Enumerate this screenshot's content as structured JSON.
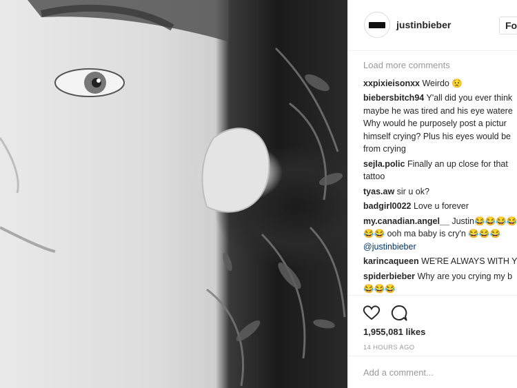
{
  "post": {
    "photo_icon": "photo-bw-portrait",
    "username": "justinbieber",
    "follow_label": "Fol",
    "load_more": "Load more comments",
    "comments": [
      {
        "author": "xxpixieisonxx",
        "text": "Weirdo 😟",
        "link": ""
      },
      {
        "author": "biebersbitch94",
        "text": "Y'all did you ever think\nmaybe he was tired and his eye watere\nWhy would he purposely post a pictur\nhimself crying? Plus his eyes would be\nfrom crying",
        "link": ""
      },
      {
        "author": "sejla.polic",
        "text": "Finally an up close for that\ntattoo",
        "link": ""
      },
      {
        "author": "tyas.aw",
        "text": "sir u ok?",
        "link": ""
      },
      {
        "author": "badgirl0022",
        "text": "Love u forever",
        "link": ""
      },
      {
        "author": "my.canadian.angel__",
        "text": "Justin😂😂😂😂\n😂😂 ooh ma baby is cry'n 😂😂😂",
        "link": "@justinbieber"
      },
      {
        "author": "karincaqueen",
        "text": "WE'RE ALWAYS WITH Y",
        "link": ""
      },
      {
        "author": "spiderbieber",
        "text": "Why are you crying my b\n😂😂😂",
        "link": ""
      }
    ],
    "likes": "1,955,081 likes",
    "time": "14 HOURS AGO",
    "add_comment_placeholder": "Add a comment..."
  },
  "icons": {
    "like": "heart-icon",
    "comment": "comment-bubble-icon"
  },
  "colors": {
    "text": "#262626",
    "muted": "#999999",
    "border": "#efefef",
    "link": "#003569"
  }
}
